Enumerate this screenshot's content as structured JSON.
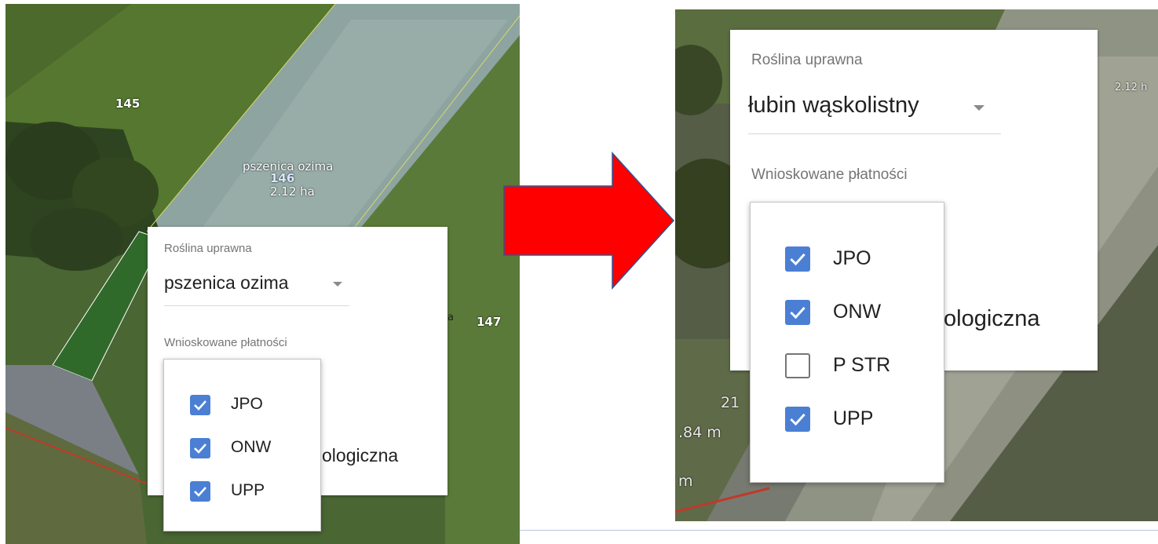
{
  "left": {
    "map_labels": {
      "parcel_145": "145",
      "crop_name": "pszenica ozima",
      "parcel_146": "146",
      "area": "2.12 ha",
      "parcel_147": "147",
      "cut_a": "a"
    },
    "form": {
      "crop_label": "Roślina uprawna",
      "crop_value": "pszenica ozima",
      "payments_label": "Wnioskowane płatności",
      "behind_text": "ologiczna",
      "options": [
        {
          "label": "JPO",
          "checked": true
        },
        {
          "label": "ONW",
          "checked": true
        },
        {
          "label": "UPP",
          "checked": true
        }
      ]
    }
  },
  "right": {
    "map_labels": {
      "area_partial": "2.12 h",
      "distance": ".84 m",
      "num_21": "21",
      "m_partial": "m"
    },
    "form": {
      "crop_label": "Roślina uprawna",
      "crop_value": "łubin wąskolistny",
      "payments_label": "Wnioskowane płatności",
      "behind_text": "ologiczna",
      "options": [
        {
          "label": "JPO",
          "checked": true
        },
        {
          "label": "ONW",
          "checked": true
        },
        {
          "label": "P STR",
          "checked": false
        },
        {
          "label": "UPP",
          "checked": true
        }
      ]
    }
  },
  "colors": {
    "arrow": "#ff0000",
    "arrow_outline": "#2f5597",
    "checkbox": "#4a7fd4"
  },
  "icons": [
    "dropdown-caret-icon",
    "checkmark-icon",
    "right-arrow-icon"
  ]
}
